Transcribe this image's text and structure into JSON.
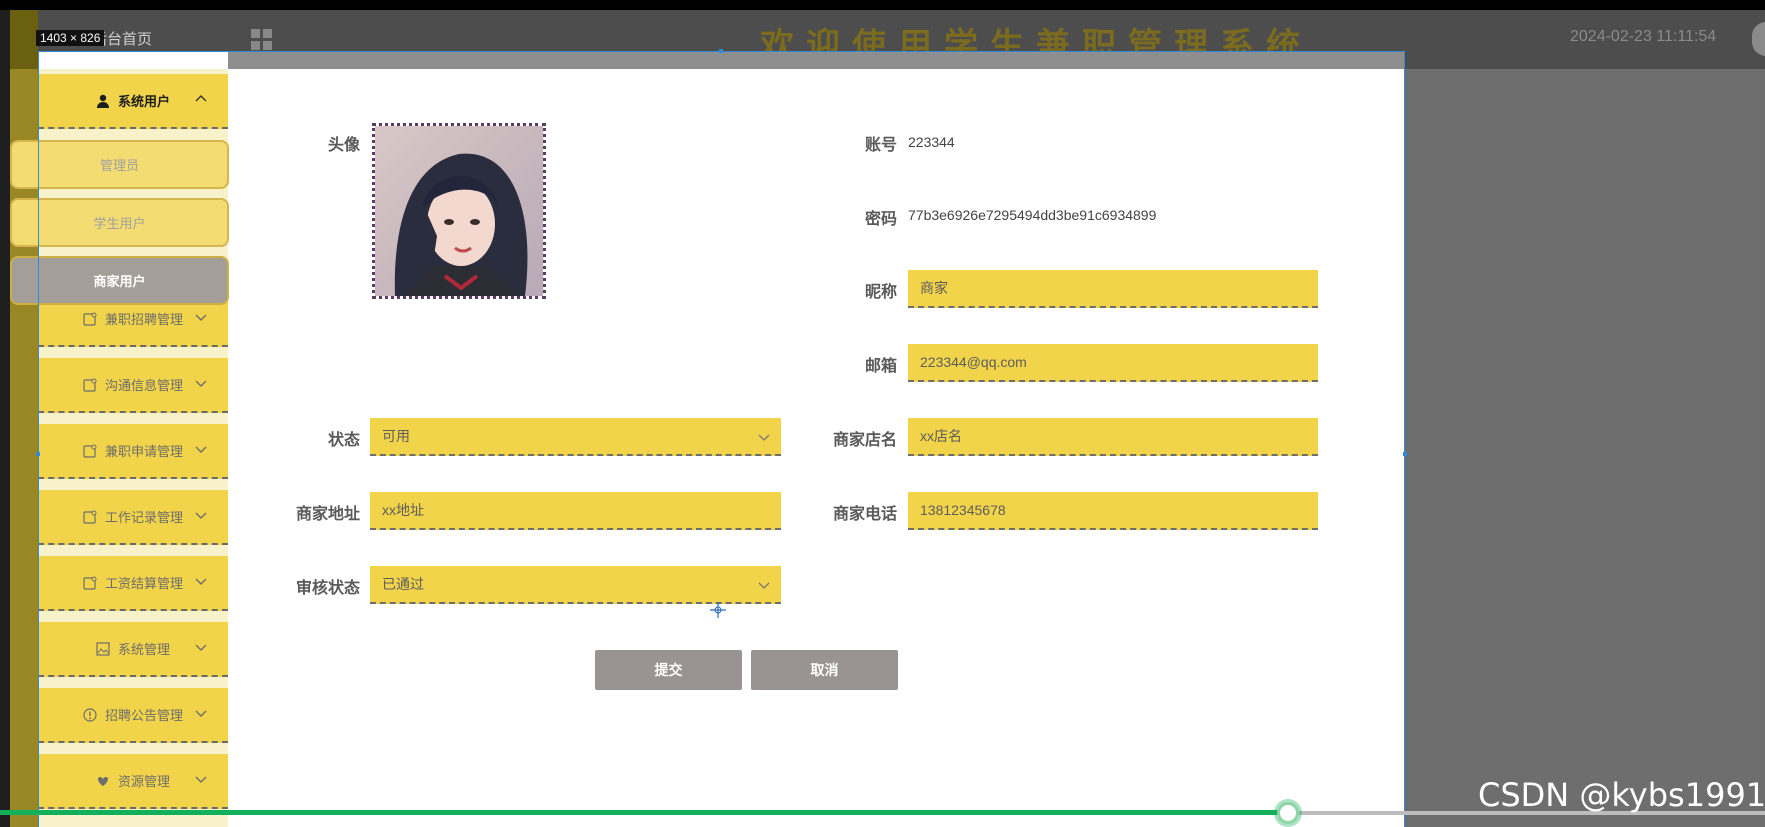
{
  "app": {
    "title": "欢迎使用学生兼职管理系统",
    "home_link": "后台首页",
    "datetime": "2024-02-23 11:11:54",
    "dimensions_badge": "1403 × 826"
  },
  "sidebar": {
    "groups": [
      {
        "label": "系统用户",
        "icon": "user-icon",
        "expanded": true
      },
      {
        "label": "兼职招聘管理",
        "icon": "note-icon",
        "expanded": false
      },
      {
        "label": "沟通信息管理",
        "icon": "note-icon",
        "expanded": false
      },
      {
        "label": "兼职申请管理",
        "icon": "note-icon",
        "expanded": false
      },
      {
        "label": "工作记录管理",
        "icon": "note-icon",
        "expanded": false
      },
      {
        "label": "工资结算管理",
        "icon": "note-icon",
        "expanded": false
      },
      {
        "label": "系统管理",
        "icon": "image-icon",
        "expanded": false
      },
      {
        "label": "招聘公告管理",
        "icon": "info-icon",
        "expanded": false
      },
      {
        "label": "资源管理",
        "icon": "heart-icon",
        "expanded": false
      }
    ],
    "sub_items": [
      {
        "label": "管理员",
        "active": false
      },
      {
        "label": "学生用户",
        "active": false
      },
      {
        "label": "商家用户",
        "active": true
      }
    ]
  },
  "form": {
    "avatar_label": "头像",
    "account_label": "账号",
    "account_value": "223344",
    "password_label": "密码",
    "password_value": "77b3e6926e7295494dd3be91c6934899",
    "nickname_label": "昵称",
    "nickname_value": "商家",
    "email_label": "邮箱",
    "email_value": "223344@qq.com",
    "status_label": "状态",
    "status_value": "可用",
    "shop_name_label": "商家店名",
    "shop_name_value": "xx店名",
    "address_label": "商家地址",
    "address_value": "xx地址",
    "phone_label": "商家电话",
    "phone_value": "13812345678",
    "review_label": "审核状态",
    "review_value": "已通过",
    "submit_label": "提交",
    "cancel_label": "取消"
  },
  "player": {
    "progress": 0.73,
    "watermark": "CSDN @kybs1991"
  },
  "colors": {
    "accent": "#f2d44a",
    "active_item": "#a39e98",
    "progress": "#12b05a"
  }
}
